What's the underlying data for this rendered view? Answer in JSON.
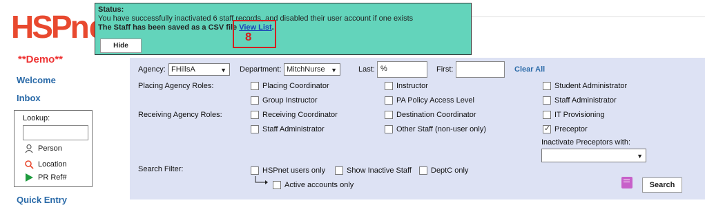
{
  "logo": {
    "part1": "HSP",
    "part2": "net"
  },
  "demo_label": "**Demo**",
  "nav": {
    "welcome": "Welcome",
    "inbox": "Inbox",
    "quick_entry": "Quick Entry"
  },
  "lookup": {
    "label": "Lookup:",
    "person": "Person",
    "location": "Location",
    "pr_ref": "PR Ref#"
  },
  "status": {
    "title": "Status:",
    "line1": "You have successfully inactivated 6 staff records, and disabled their user account if one exists",
    "line2_prefix": "The Staff has been saved as a CSV file ",
    "view_list": "View List",
    "line2_suffix": ".",
    "hide_label": "Hide",
    "highlight_number": "8"
  },
  "filters": {
    "agency_label": "Agency:",
    "agency_value": "FHillsA",
    "department_label": "Department:",
    "department_value": "MitchNurse",
    "last_label": "Last:",
    "last_value": "%",
    "first_label": "First:",
    "first_value": "",
    "clear_all": "Clear All"
  },
  "placing_roles_label": "Placing Agency Roles:",
  "receiving_roles_label": "Receiving Agency Roles:",
  "roles": {
    "placing_coordinator": "Placing Coordinator",
    "instructor": "Instructor",
    "student_administrator": "Student Administrator",
    "group_instructor": "Group Instructor",
    "pa_policy_access_level": "PA Policy Access Level",
    "staff_administrator_placing": "Staff Administrator",
    "receiving_coordinator": "Receiving Coordinator",
    "destination_coordinator": "Destination Coordinator",
    "it_provisioning": "IT Provisioning",
    "staff_administrator_receiving": "Staff Administrator",
    "other_staff": "Other Staff (non-user only)",
    "preceptor": "Preceptor"
  },
  "inactivate_preceptors_label": "Inactivate Preceptors with:",
  "inactivate_preceptors_value": "",
  "search_filter": {
    "label": "Search Filter:",
    "hspnet_users_only": "HSPnet users only",
    "show_inactive_staff": "Show Inactive Staff",
    "deptc_only": "DeptC only",
    "active_accounts_only": "Active accounts only"
  },
  "search_button": "Search"
}
